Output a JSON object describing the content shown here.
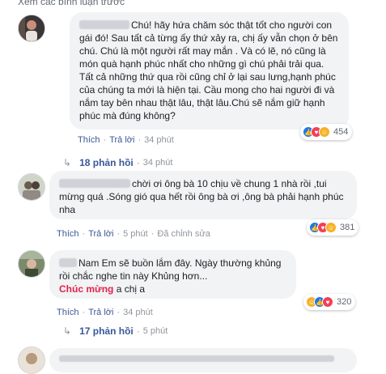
{
  "header": {
    "view_previous": "Xem các bình luận trước"
  },
  "comments": [
    {
      "text": "Chú! hãy hứa chăm sóc thật tốt cho người con gái đó! Sau tất cả từng ấy thứ xảy ra, chị ấy vẫn chọn ở bên chú. Chú là một người rất may mắn . Và có lẽ, nó cũng là món quà hạnh phúc nhất cho những gì chú phải trải qua. Tất cả những thứ qua rồi cũng chỉ ở lại sau lưng,hạnh phúc của chúng ta mới là hiện tại. Cầu mong cho hai người đi và nắm tay bên nhau thật lâu, thật lâu.Chú sẽ nắm giữ hạnh phúc mà đúng không?",
      "reaction_count": "454",
      "reactions": [
        "like-icon",
        "love-icon",
        "haha-icon"
      ],
      "like": "Thích",
      "reply": "Trả lời",
      "time": "34 phút",
      "replies_label": "18 phản hồi",
      "replies_time": "34 phút"
    },
    {
      "text": "chời ơi ông bà 10 chịu về chung 1 nhà rồi ,tui mừng quá .Sóng gió qua hết rồi ông bà ơi ,ông bà phải hạnh phúc nha",
      "reaction_count": "381",
      "reactions": [
        "like-icon",
        "love-icon",
        "haha-icon"
      ],
      "like": "Thích",
      "reply": "Trả lời",
      "time": "5 phút",
      "edited": "Đã chỉnh sửa"
    },
    {
      "text": "Nam Em sẽ buồn lắm đây. Ngày thường khủng rồi chắc nghe tin này Khủng hơn...",
      "mention": "Chúc mừng",
      "text_after_mention": "a chị a",
      "reaction_count": "320",
      "reactions": [
        "haha-icon",
        "like-icon",
        "love-icon"
      ],
      "like": "Thích",
      "reply": "Trả lời",
      "time": "34 phút",
      "replies_label": "17 phản hồi",
      "replies_time": "5 phút"
    }
  ],
  "colors": {
    "link": "#385898",
    "muted": "#90949c",
    "bubble": "#f2f3f5",
    "mention": "#e0244a"
  }
}
